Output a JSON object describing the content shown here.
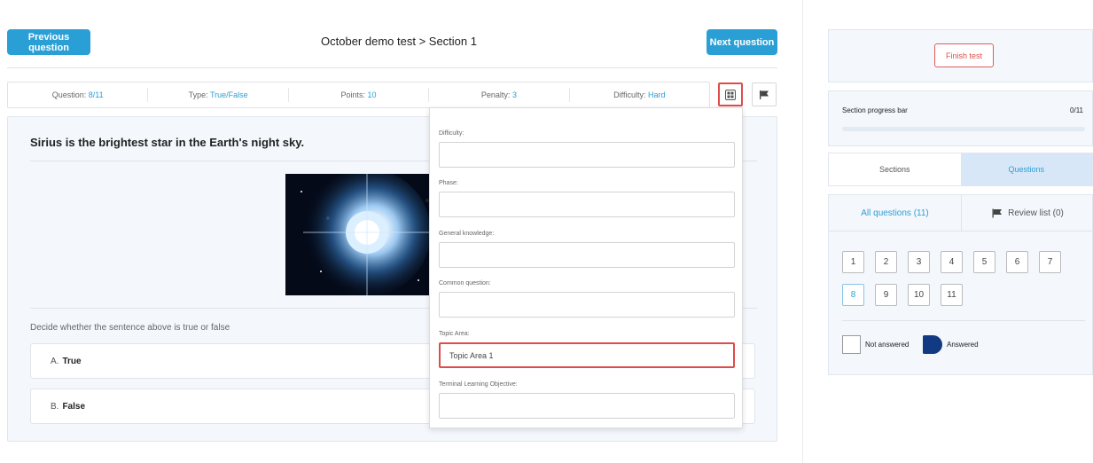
{
  "header": {
    "prev_label": "Previous question",
    "next_label": "Next question",
    "breadcrumb": "October demo test > Section 1"
  },
  "info_bar": {
    "question_label": "Question:",
    "question_value": "8/11",
    "type_label": "Type:",
    "type_value": "True/False",
    "points_label": "Points:",
    "points_value": "10",
    "penalty_label": "Penalty:",
    "penalty_value": "3",
    "difficulty_label": "Difficulty:",
    "difficulty_value": "Hard"
  },
  "question": {
    "text": "Sirius is the brightest star in the Earth's night sky.",
    "instruction": "Decide whether the sentence above is true or false",
    "answers": [
      {
        "letter": "A.",
        "text": "True"
      },
      {
        "letter": "B.",
        "text": "False"
      }
    ]
  },
  "metadata": {
    "fields": [
      {
        "label": "Difficulty:",
        "value": ""
      },
      {
        "label": "Phase:",
        "value": ""
      },
      {
        "label": "General knowledge:",
        "value": ""
      },
      {
        "label": "Common question:",
        "value": ""
      },
      {
        "label": "Topic Area:",
        "value": "Topic Area 1"
      },
      {
        "label": "Terminal Learning Objective:",
        "value": ""
      }
    ]
  },
  "sidebar": {
    "finish_label": "Finish test",
    "progress_label": "Section progress bar",
    "progress_count": "0/11",
    "progress_fraction": 0,
    "tabs": {
      "sections": "Sections",
      "questions": "Questions"
    },
    "subtabs": {
      "all": "All questions (11)",
      "review": "Review list (0)"
    },
    "question_numbers": [
      "1",
      "2",
      "3",
      "4",
      "5",
      "6",
      "7",
      "8",
      "9",
      "10",
      "11"
    ],
    "active_question": "8",
    "legend": {
      "not_answered": "Not answered",
      "answered": "Answered"
    }
  },
  "colors": {
    "accent": "#2a9fd6",
    "highlight": "#e04b4b",
    "answered": "#123a82"
  },
  "icons": {
    "grid": "grid-icon",
    "flag": "flag-icon"
  }
}
